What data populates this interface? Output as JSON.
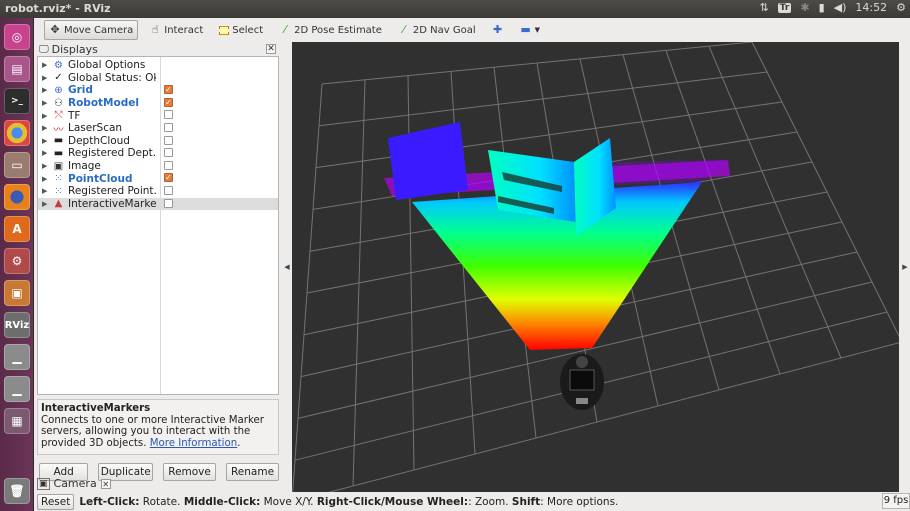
{
  "window_title": "robot.rviz* - RViz",
  "tray": {
    "clock": "14:52",
    "keyboard": "Tr"
  },
  "toolbar": {
    "tools": [
      {
        "label": "Move Camera",
        "icon": "move-camera-icon",
        "active": true
      },
      {
        "label": "Interact",
        "icon": "hand-icon",
        "active": false
      },
      {
        "label": "Select",
        "icon": "select-box-icon",
        "active": false
      },
      {
        "label": "2D Pose Estimate",
        "icon": "pose-arrow-icon",
        "active": false
      },
      {
        "label": "2D Nav Goal",
        "icon": "goal-arrow-icon",
        "active": false
      }
    ]
  },
  "displays": {
    "title": "Displays",
    "items": [
      {
        "label": "Global Options",
        "icon": "gear-icon",
        "checkbox": null,
        "bold": false
      },
      {
        "label": "Global Status: Ok",
        "icon": "check-icon",
        "checkbox": null,
        "bold": false
      },
      {
        "label": "Grid",
        "icon": "grid-icon",
        "checkbox": true,
        "bold": true
      },
      {
        "label": "RobotModel",
        "icon": "robot-icon",
        "checkbox": true,
        "bold": true
      },
      {
        "label": "TF",
        "icon": "tf-icon",
        "checkbox": false,
        "bold": false
      },
      {
        "label": "LaserScan",
        "icon": "laser-icon",
        "checkbox": false,
        "bold": false
      },
      {
        "label": "DepthCloud",
        "icon": "camera-icon",
        "checkbox": false,
        "bold": false
      },
      {
        "label": "Registered Dept...",
        "icon": "camera-icon",
        "checkbox": false,
        "bold": false
      },
      {
        "label": "Image",
        "icon": "image-icon",
        "checkbox": false,
        "bold": false
      },
      {
        "label": "PointCloud",
        "icon": "pointcloud-icon",
        "checkbox": true,
        "bold": true
      },
      {
        "label": "Registered Point...",
        "icon": "pointcloud-icon",
        "checkbox": false,
        "bold": false
      },
      {
        "label": "InteractiveMarkers",
        "icon": "marker-icon",
        "checkbox": false,
        "bold": false
      }
    ]
  },
  "info": {
    "title": "InteractiveMarkers",
    "text": "Connects to one or more Interactive Marker servers, allowing you to interact with the provided 3D objects.",
    "link": "More Information",
    "period": "."
  },
  "buttons": {
    "add": "Add",
    "duplicate": "Duplicate",
    "remove": "Remove",
    "rename": "Rename"
  },
  "camera_tab": "Camera",
  "status": {
    "reset": "Reset",
    "hint_parts": [
      {
        "b": "Left-Click:",
        "t": " Rotate. "
      },
      {
        "b": "Middle-Click:",
        "t": " Move X/Y. "
      },
      {
        "b": "Right-Click/Mouse Wheel:",
        "t": ": Zoom. "
      },
      {
        "b": "Shift",
        "t": ": More options."
      }
    ],
    "fps": "9 fps"
  },
  "colors": {
    "checkbox_on": "#e07d3c",
    "bold_item": "#2a6bc6",
    "viewport_bg": "#303030",
    "launcher": "#5a2a48"
  }
}
